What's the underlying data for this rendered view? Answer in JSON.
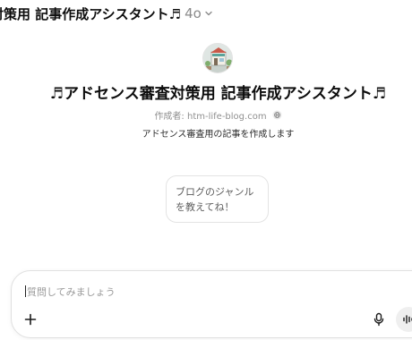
{
  "header": {
    "title": "対策用 記事作成アシスタント♬",
    "model": "4o",
    "chevron_icon": "chevron-down-icon"
  },
  "gpt": {
    "avatar_icon": "shop-illustration-avatar",
    "name": "♬アドセンス審査対策用 記事作成アシスタント♬",
    "creator": "作成者: htm-life-blog.com",
    "creator_icon": "globe-icon",
    "description": "アドセンス審査用の記事を作成します"
  },
  "starters": [
    {
      "text": "ブログのジャンルを教えてね！"
    }
  ],
  "composer": {
    "placeholder": "質問してみましょう",
    "value": "",
    "plus_icon": "plus-icon",
    "mic_icon": "microphone-icon",
    "voice_icon": "voice-waveform-icon"
  }
}
